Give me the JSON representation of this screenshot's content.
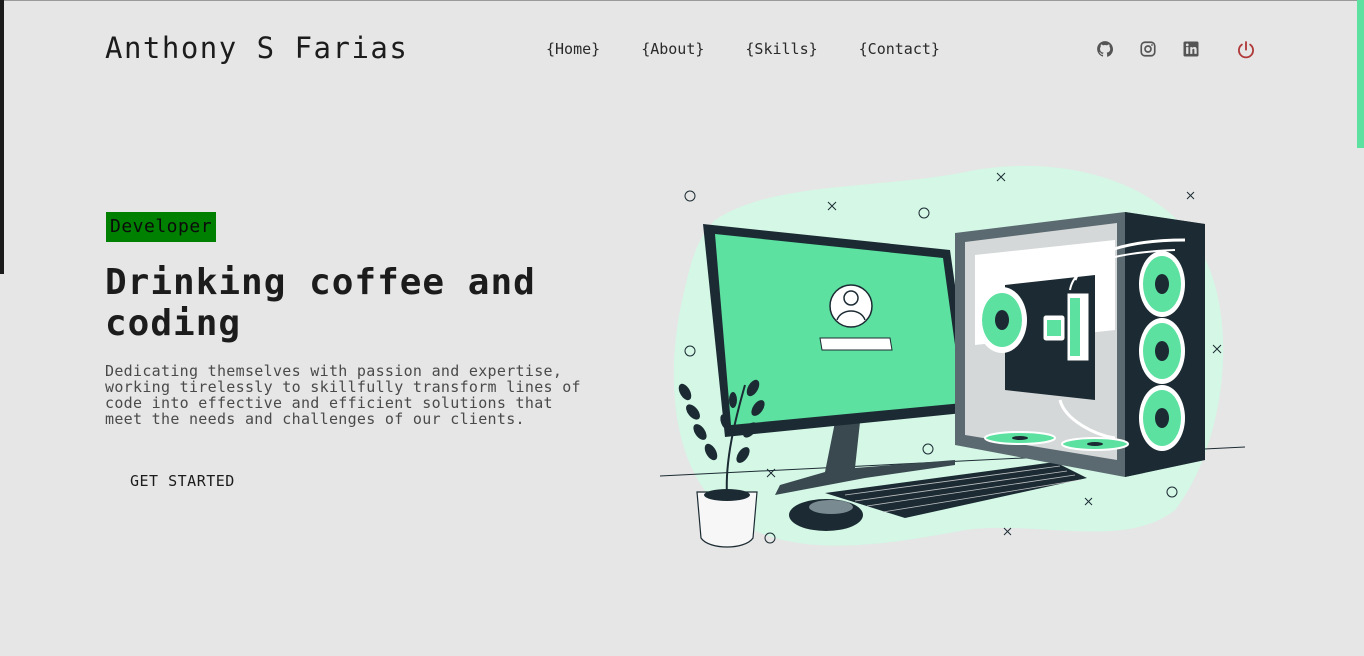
{
  "header": {
    "brand": "Anthony S Farias",
    "nav": [
      "{Home}",
      "{About}",
      "{Skills}",
      "{Contact}"
    ],
    "social_icons": [
      "github-icon",
      "instagram-icon",
      "linkedin-icon"
    ],
    "power_icon": "power-icon"
  },
  "hero": {
    "tag": "Developer",
    "headline": "Drinking coffee and coding",
    "description": "Dedicating themselves with passion and expertise, working tirelessly to skillfully transform lines of code into effective and efficient solutions that meet the needs and challenges of our clients.",
    "cta": "GET STARTED"
  },
  "colors": {
    "background": "#e6e6e6",
    "accent_green": "#5ce1a0",
    "tag_bg": "#008000",
    "power_red": "#b03a3a",
    "dark": "#1c2b33"
  }
}
